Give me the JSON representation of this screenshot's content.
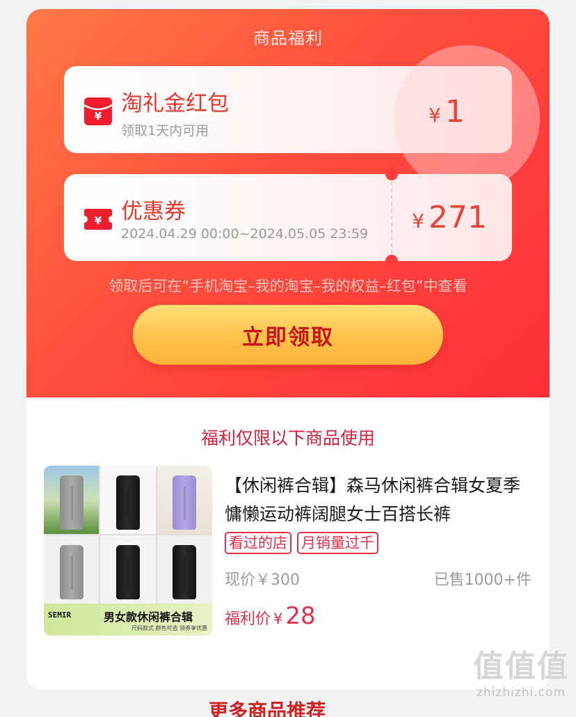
{
  "top": {
    "title": "商品福利",
    "coupons": [
      {
        "icon": "red-envelope-icon",
        "title": "淘礼金红包",
        "subtitle": "领取1天内可用",
        "currency": "¥",
        "amount": "1"
      },
      {
        "icon": "coupon-ticket-icon",
        "title": "优惠券",
        "subtitle": "2024.04.29 00:00~2024.05.05 23:59",
        "currency": "¥",
        "amount": "271"
      }
    ],
    "tip": "领取后可在“手机淘宝–我的淘宝–我的权益–红包”中查看",
    "claim_button": "立即领取"
  },
  "product_section": {
    "title": "福利仅限以下商品使用",
    "product": {
      "image_banner_brand": "SEMIR",
      "image_banner_title": "男女款休闲裤合辑",
      "image_banner_sub": "尺码款式  颜色可选  领券享优惠",
      "title": "【休闲裤合辑】森马休闲裤合辑女夏季慵懒运动裤阔腿女士百搭长裤",
      "tags": [
        "看过的店",
        "月销量过千"
      ],
      "price_now": "现价￥300",
      "sold": "已售1000+件",
      "welfare_label": "福利价",
      "welfare_currency": "¥",
      "welfare_price": "28"
    }
  },
  "below_text": "更多商品推荐",
  "watermark": {
    "glyphs": "值值值",
    "url": "zhizhizhi.com"
  },
  "colors": {
    "accent_red": "#e0304a",
    "gradient_start": "#ff7a45",
    "gradient_end": "#ff2f3a",
    "button_yellow": "#ffc24a"
  }
}
